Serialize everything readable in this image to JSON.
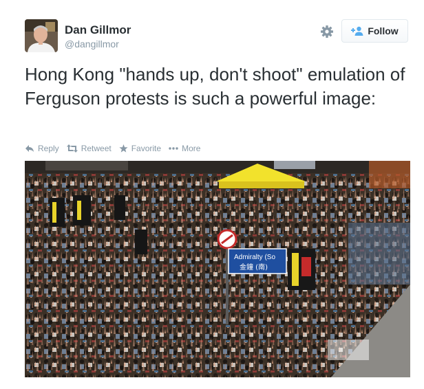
{
  "user": {
    "name": "Dan Gillmor",
    "handle": "@dangillmor"
  },
  "follow": {
    "label": "Follow"
  },
  "tweet": {
    "text": "Hong Kong \"hands up, don't shoot\" emulation of Ferguson protests is such a powerful image:"
  },
  "actions": {
    "reply": "Reply",
    "retweet": "Retweet",
    "favorite": "Favorite",
    "more": "More"
  },
  "photo": {
    "street_sign_line1": "Admiralty (So",
    "street_sign_line2": "金鐘 (南)"
  },
  "colors": {
    "text": "#292f33",
    "muted": "#8899a6",
    "follow_icon": "#55acee"
  }
}
